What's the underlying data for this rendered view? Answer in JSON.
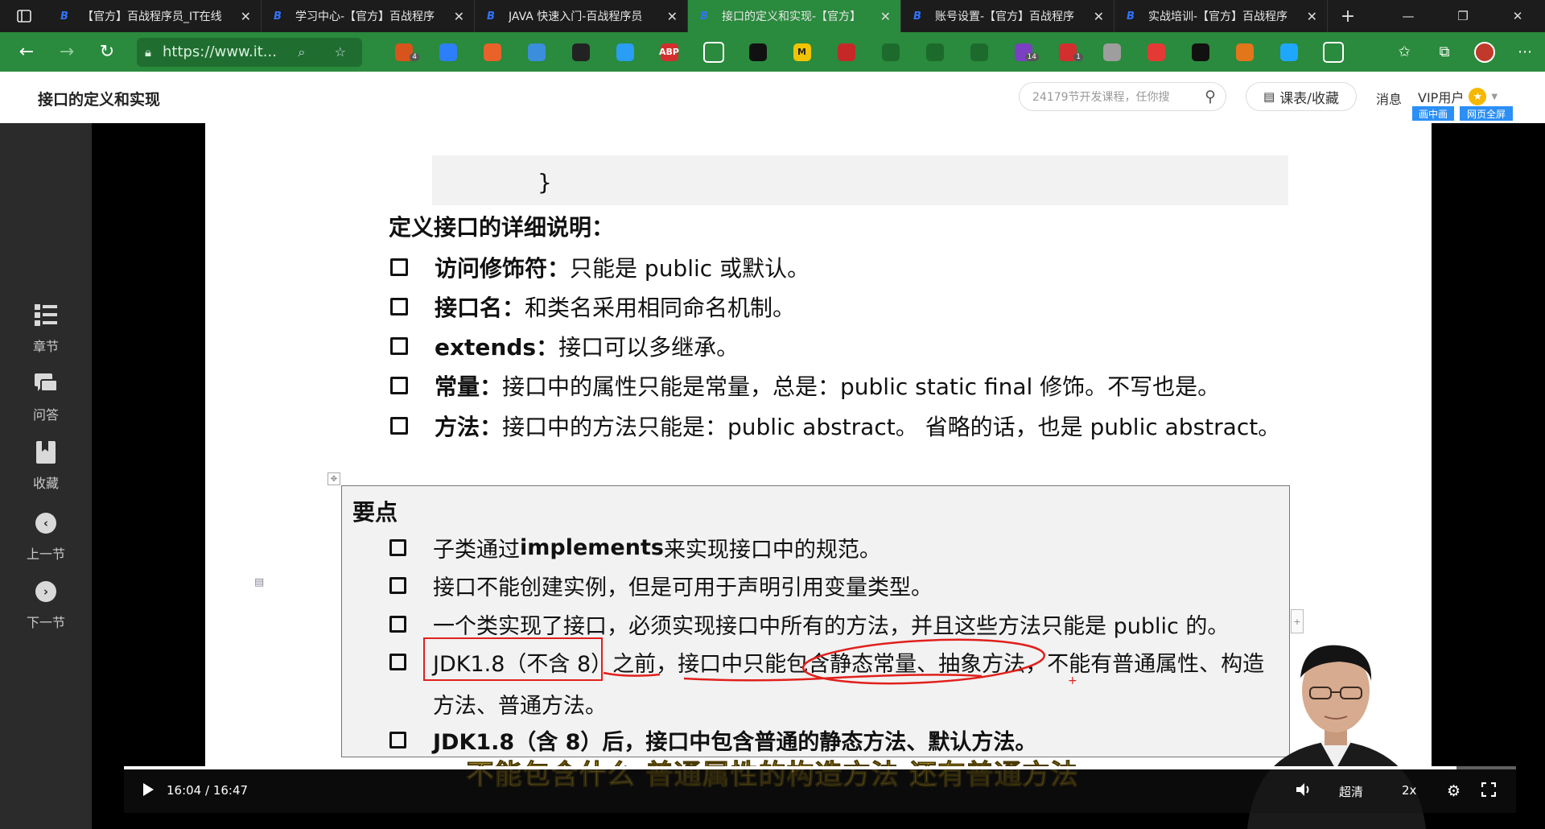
{
  "browser": {
    "tabs": [
      {
        "title": "【官方】百战程序员_IT在线"
      },
      {
        "title": "学习中心-【官方】百战程序"
      },
      {
        "title": "JAVA 快速入门-百战程序员"
      },
      {
        "title": "接口的定义和实现-【官方】"
      },
      {
        "title": "账号设置-【官方】百战程序"
      },
      {
        "title": "实战培训-【官方】百战程序"
      }
    ],
    "url": "https://www.it...",
    "extensions": [
      {
        "name": "cookie-extension-icon",
        "badge": "4",
        "color": "#d9541c"
      },
      {
        "name": "tiktok-extension-icon",
        "badge": "",
        "color": "#2d7ff9"
      },
      {
        "name": "notes-extension-icon",
        "badge": "",
        "color": "#e8622a"
      },
      {
        "name": "grid-extension-icon",
        "badge": "",
        "color": "#3b8edb"
      },
      {
        "name": "calculator-extension-icon",
        "badge": "",
        "color": "#222222"
      },
      {
        "name": "gem-extension-icon",
        "badge": "",
        "color": "#2a9df4"
      },
      {
        "name": "adblock-extension-icon",
        "badge": "",
        "color": "#d32f2f",
        "text": "ABP"
      },
      {
        "name": "mountain-extension-icon",
        "badge": "",
        "color": "#ffffff"
      },
      {
        "name": "asterisk-extension-icon",
        "badge": "",
        "color": "#111111"
      },
      {
        "name": "m-extension-icon",
        "badge": "",
        "color": "#f2c300",
        "text": "M"
      },
      {
        "name": "block-extension-icon",
        "badge": "",
        "color": "#c62828"
      },
      {
        "name": "bracket-extension-icon",
        "badge": "",
        "color": "#1d6b2c"
      },
      {
        "name": "diamond-extension-icon",
        "badge": "",
        "color": "#1d6b2c"
      },
      {
        "name": "curly-extension-icon",
        "badge": "",
        "color": "#1d6b2c"
      },
      {
        "name": "purple-extension-icon",
        "badge": "14",
        "color": "#7b3fc4"
      },
      {
        "name": "red-dots-extension-icon",
        "badge": "1",
        "color": "#d32f2f"
      },
      {
        "name": "camera-extension-icon",
        "badge": "",
        "color": "#9e9e9e"
      },
      {
        "name": "refresh-red-extension-icon",
        "badge": "",
        "color": "#e53935"
      },
      {
        "name": "circle-extension-icon",
        "badge": "",
        "color": "#111111"
      },
      {
        "name": "fox-extension-icon",
        "badge": "",
        "color": "#e2761b"
      },
      {
        "name": "shield-extension-icon",
        "badge": "",
        "color": "#1ea7fd"
      },
      {
        "name": "puzzle-extension-icon",
        "badge": "",
        "color": "#ffffff"
      }
    ]
  },
  "header": {
    "page_title": "接口的定义和实现",
    "search_placeholder": "24179节开发课程，任你搜",
    "favorites_label": "课表/收藏",
    "messages_label": "消息",
    "user_label": "VIP用户",
    "pip_label": "画中画",
    "fullscreen_label": "网页全屏"
  },
  "sidebar": {
    "items": [
      {
        "label": "章节",
        "icon": "chapters-icon"
      },
      {
        "label": "问答",
        "icon": "qa-icon"
      },
      {
        "label": "收藏",
        "icon": "bookmark-icon"
      },
      {
        "label": "上一节",
        "icon": "prev-icon"
      },
      {
        "label": "下一节",
        "icon": "next-icon"
      }
    ]
  },
  "slide": {
    "code_closing_brace": "}",
    "section_title": "定义接口的详细说明：",
    "bullets": [
      {
        "bold": "访问修饰符：",
        "text": "只能是 public 或默认。"
      },
      {
        "bold": "接口名：",
        "text": "和类名采用相同命名机制。"
      },
      {
        "bold": "extends：",
        "text": "接口可以多继承。"
      },
      {
        "bold": "常量：",
        "text": "接口中的属性只能是常量，总是：public static final 修饰。不写也是。"
      },
      {
        "bold": "方法：",
        "text": "接口中的方法只能是：public abstract。 省略的话，也是 public abstract。"
      }
    ],
    "key_title": "要点",
    "key_points": [
      {
        "pre": "子类通过 ",
        "bold": "implements",
        "post": " 来实现接口中的规范。"
      },
      {
        "pre": "接口不能创建实例，但是可用于声明引用变量类型。",
        "bold": "",
        "post": ""
      },
      {
        "pre": "一个类实现了接口，必须实现接口中所有的方法，并且这些方法只能是 public 的。",
        "bold": "",
        "post": ""
      },
      {
        "pre": "JDK1.8（不含 8）之前，接口中只能包含静态常量、抽象方法，不能有普通属性、构造",
        "bold": "",
        "post": ""
      },
      {
        "pre": "",
        "bold": "JDK1.8（含 8）后，接口中包含普通的静态方法、默认方法。",
        "post": ""
      }
    ],
    "key_point_continuation": "方法、普通方法。"
  },
  "player": {
    "subtitle": "不能包含什么 普通属性的构造方法 还有普通方法",
    "current_time": "16:04",
    "duration": "16:47",
    "progress_fraction": 0.957,
    "quality_label": "超清",
    "speed_label": "2x"
  }
}
